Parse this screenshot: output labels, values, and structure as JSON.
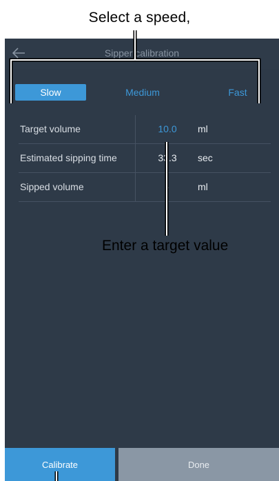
{
  "callouts": {
    "top": "Select a speed,",
    "middle": "Enter a target value"
  },
  "appbar": {
    "title": "Sipper calibration",
    "back_icon": "arrow-left-icon"
  },
  "speed": {
    "options": [
      "Slow",
      "Medium",
      "Fast"
    ],
    "selected": "Slow"
  },
  "table": {
    "rows": [
      {
        "label": "Target volume",
        "value": "10.0",
        "unit": "ml"
      },
      {
        "label": "Estimated sipping time",
        "value": "33.3",
        "unit": "sec"
      },
      {
        "label": "Sipped volume",
        "value": "-",
        "unit": "ml"
      }
    ]
  },
  "buttons": {
    "calibrate": "Calibrate",
    "done": "Done"
  },
  "colors": {
    "background": "#2e3a48",
    "accent": "#3d98d8",
    "done_button": "#8a97a5"
  }
}
